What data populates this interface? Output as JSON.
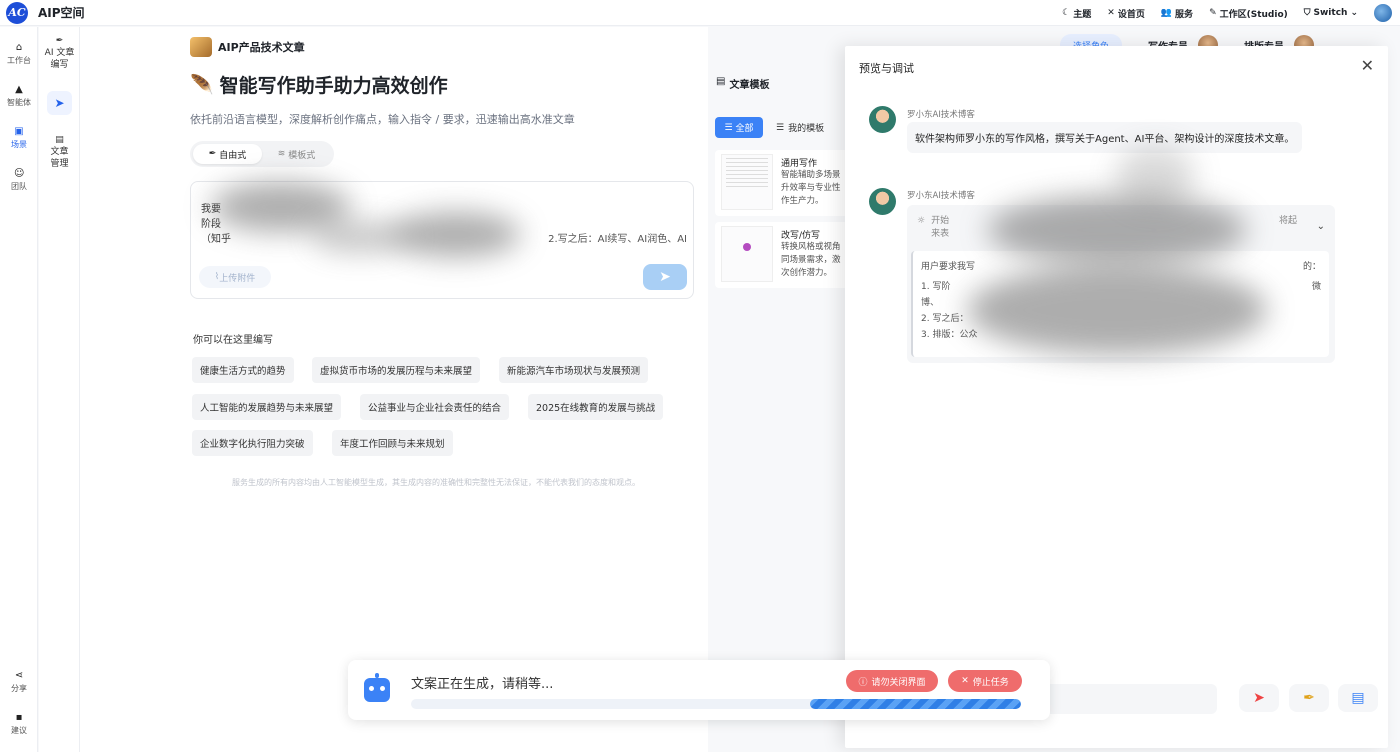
{
  "app": {
    "logo_text": "AC",
    "title": "AIP空间"
  },
  "topbar": {
    "items": [
      {
        "icon": "moon-icon",
        "label": "主题"
      },
      {
        "icon": "tools-icon",
        "label": "设首页"
      },
      {
        "icon": "users-icon",
        "label": "服务"
      },
      {
        "icon": "pen-icon",
        "label": "工作区(Studio)"
      },
      {
        "icon": "shield-icon",
        "label": "Switch"
      }
    ]
  },
  "rail": {
    "items": [
      {
        "icon": "home-icon",
        "label": "工作台"
      },
      {
        "icon": "agent-icon",
        "label": "智能体"
      },
      {
        "icon": "scene-icon",
        "label": "场景"
      },
      {
        "icon": "team-icon",
        "label": "团队"
      }
    ],
    "share": "分享",
    "feedback": "建议"
  },
  "subnav": {
    "write": "AI 文章编写",
    "manage": "文章管理"
  },
  "main": {
    "doc_head": "AIP产品技术文章",
    "title": "智能写作助手助力高效创作",
    "subtitle": "依托前沿语言模型，深度解析创作痛点，输入指令 / 要求，迅速输出高水准文章",
    "modes": [
      "自由式",
      "模板式"
    ],
    "editor_line1": "我要",
    "editor_line2": "阶段",
    "editor_line3": "（知乎",
    "editor_tail": "2.写之后：AI续写、AI润色、AI",
    "upload": "上传附件",
    "hint_label": "你可以在这里编写",
    "chips": [
      "健康生活方式的趋势",
      "虚拟货币市场的发展历程与未来展望",
      "新能源汽车市场现状与发展预测",
      "人工智能的发展趋势与未来展望",
      "公益事业与企业社会责任的结合",
      "2025在线教育的发展与挑战",
      "企业数字化执行阻力突破",
      "年度工作回顾与未来规划"
    ],
    "disclaimer": "服务生成的所有内容均由人工智能模型生成，其生成内容的准确性和完整性无法保证，不能代表我们的态度和观点。"
  },
  "templates": {
    "heading": "文章模板",
    "tab_all": "全部",
    "tab_mine": "我的模板",
    "cards": [
      {
        "name": "通用写作",
        "desc": "智能辅助多场景\n升效率与专业性\n作生产力。"
      },
      {
        "name": "改写/仿写",
        "desc": "转换风格或视角\n同场景需求，激\n次创作潜力。"
      }
    ]
  },
  "behind": {
    "pill": "选择角色",
    "a": "写作专员",
    "b": "排版专员"
  },
  "drawer": {
    "title": "预览与调试",
    "msg1_name": "罗小东AI技术博客",
    "msg1_text": "软件架构师罗小东的写作风格，撰写关于Agent、AI平台、架构设计的深度技术文章。",
    "msg2_name": "罗小东AI技术博客",
    "think_head1": "开始",
    "think_head2": "来表",
    "think_tail": "将起",
    "body_line1": "用户要求我写",
    "body_line1_tail": "的：",
    "body_line2": "1. 写阶",
    "body_line2_tail": "微",
    "body_line3": "博、",
    "body_line4": "2. 写之后：",
    "body_line5": "3. 排版：公众"
  },
  "progress": {
    "text": "文案正在生成，请稍等...",
    "fill_fraction": 0.346,
    "btn_warn": "请勿关闭界面",
    "btn_stop": "停止任务"
  }
}
